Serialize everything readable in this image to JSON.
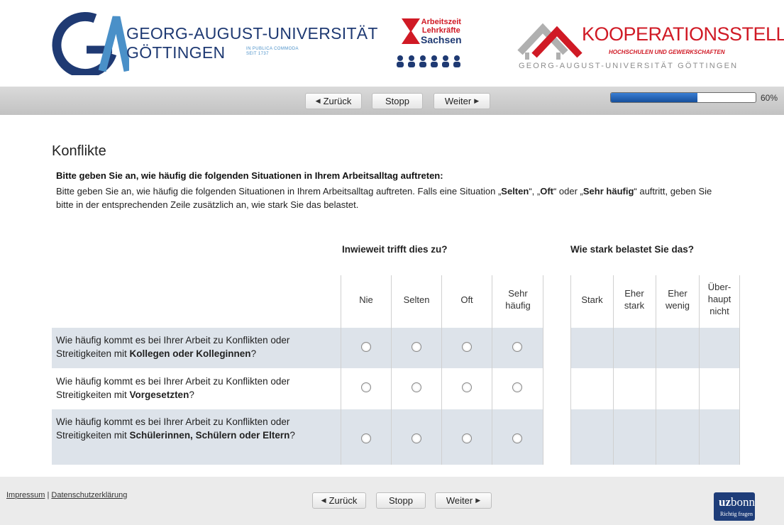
{
  "header": {
    "university_line1": "GEORG-AUGUST-UNIVERSITÄT",
    "university_line2": "GÖTTINGEN",
    "motto_line1": "IN PUBLICA COMMODA",
    "motto_line2": "SEIT 1737",
    "az_line1": "Arbeitszeit",
    "az_line2": "Lehrkräfte",
    "az_line3": "Sachsen",
    "ko_title": "KOOPERATIONSSTELLE",
    "ko_sub": "HOCHSCHULEN UND GEWERKSCHAFTEN",
    "ko_foot": "GEORG-AUGUST-UNIVERSITÄT GÖTTINGEN"
  },
  "nav": {
    "back": "Zurück",
    "stop": "Stopp",
    "next": "Weiter",
    "progress_fraction": 0.6,
    "progress_label": "60%"
  },
  "page": {
    "title": "Konflikte",
    "question": "Bitte geben Sie an, wie häufig die folgenden Situationen in Ihrem Arbeitsalltag auftreten:",
    "instruction_a": "Bitte geben Sie an, wie häufig die folgenden Situationen in Ihrem Arbeitsalltag auftreten. Falls eine Situation „",
    "instruction_b": "Selten",
    "instruction_c": "“, „",
    "instruction_d": "Oft",
    "instruction_e": "“ oder „",
    "instruction_f": "Sehr häufig",
    "instruction_g": "“ auftritt, geben Sie bitte in der entsprechenden Zeile zusätzlich an, wie stark Sie das belastet."
  },
  "matrix": {
    "group_frequency": "Inwieweit trifft dies zu?",
    "group_burden": "Wie stark belastet Sie das?",
    "frequency_columns": [
      "Nie",
      "Selten",
      "Oft",
      "Sehr häufig"
    ],
    "burden_columns": [
      "Stark",
      "Eher stark",
      "Eher wenig",
      "Über-haupt nicht"
    ],
    "rows": [
      {
        "prefix": "Wie häufig kommt es bei Ihrer Arbeit zu Konflikten oder Streitigkeiten mit ",
        "emphasis": "Kollegen oder Kolleginnen",
        "suffix": "?"
      },
      {
        "prefix": "Wie häufig kommt es bei Ihrer Arbeit zu Konflikten oder Streitigkeiten mit ",
        "emphasis": "Vorgesetzten",
        "suffix": "?"
      },
      {
        "prefix": "Wie häufig kommt es bei Ihrer Arbeit zu Konflikten oder Streitigkeiten mit ",
        "emphasis": "Schülerinnen, Schülern oder Eltern",
        "suffix": "?"
      }
    ]
  },
  "footer": {
    "impressum": "Impressum",
    "separator": "|",
    "privacy": "Datenschutzerklärung",
    "back": "Zurück",
    "stop": "Stopp",
    "next": "Weiter",
    "uz_logo_a": "uz",
    "uz_logo_b": "bonn",
    "uz_tagline": "Richtig fragen"
  },
  "colors": {
    "row_shade": "#dde3ea",
    "progress": "#1f5fb3",
    "brand_blue": "#1f3a73",
    "brand_red": "#d01a25"
  }
}
